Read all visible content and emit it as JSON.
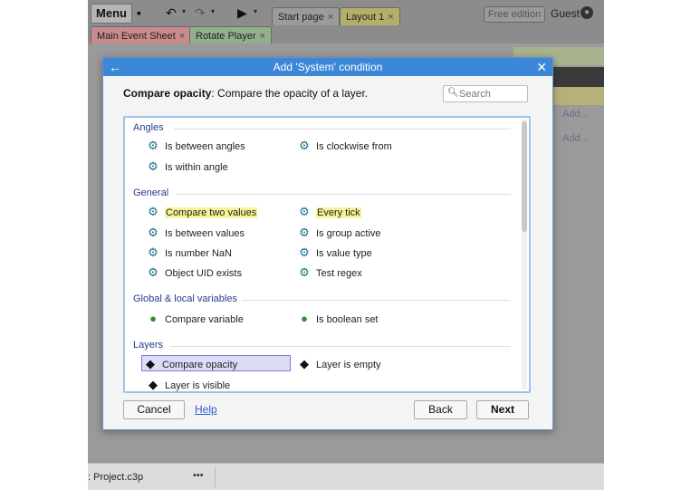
{
  "toolbar": {
    "menu_label": "Menu",
    "save_icon": "save-icon",
    "undo_icon": "undo-icon",
    "redo_icon": "redo-icon",
    "play_icon": "play-icon",
    "edition_badge": "Free edition",
    "user": "Guest"
  },
  "project_tabs": [
    {
      "label": "Start page",
      "close": "×"
    },
    {
      "label": "Layout 1",
      "close": "×"
    }
  ],
  "sheet_tabs": [
    {
      "label": "Main Event Sheet",
      "close": "×"
    },
    {
      "label": "Rotate Player",
      "close": "×"
    }
  ],
  "background": {
    "add_labels": [
      "Add...",
      "Add..."
    ],
    "status_file": ": Project.c3p",
    "status_dots": "•••"
  },
  "dialog": {
    "title": "Add 'System' condition",
    "back_icon": "←",
    "close_icon": "✕",
    "description_bold": "Compare opacity",
    "description_rest": ": Compare the opacity of a layer.",
    "search_placeholder": "Search",
    "categories": [
      {
        "name": "Angles",
        "items": [
          {
            "label": "Is between angles",
            "icon": "gear-icon"
          },
          {
            "label": "Is clockwise from",
            "icon": "gear-icon"
          },
          {
            "label": "Is within angle",
            "icon": "gear-icon"
          }
        ]
      },
      {
        "name": "General",
        "items": [
          {
            "label": "Compare two values",
            "icon": "gear-icon",
            "highlighted": true
          },
          {
            "label": "Every tick",
            "icon": "gear-icon",
            "highlighted": true
          },
          {
            "label": "Is between values",
            "icon": "gear-icon"
          },
          {
            "label": "Is group active",
            "icon": "gear-icon"
          },
          {
            "label": "Is number NaN",
            "icon": "gear-icon"
          },
          {
            "label": "Is value type",
            "icon": "gear-icon"
          },
          {
            "label": "Object UID exists",
            "icon": "gear-icon"
          },
          {
            "label": "Test regex",
            "icon": "gear-icon"
          }
        ]
      },
      {
        "name": "Global & local variables",
        "items": [
          {
            "label": "Compare variable",
            "icon": "globe-icon"
          },
          {
            "label": "Is boolean set",
            "icon": "globe-icon"
          }
        ]
      },
      {
        "name": "Layers",
        "items": [
          {
            "label": "Compare opacity",
            "icon": "layers-icon",
            "selected": true
          },
          {
            "label": "Layer is empty",
            "icon": "layers-icon"
          },
          {
            "label": "Layer is visible",
            "icon": "layers-icon"
          }
        ]
      }
    ],
    "buttons": {
      "cancel": "Cancel",
      "help": "Help",
      "back": "Back",
      "next": "Next"
    }
  }
}
